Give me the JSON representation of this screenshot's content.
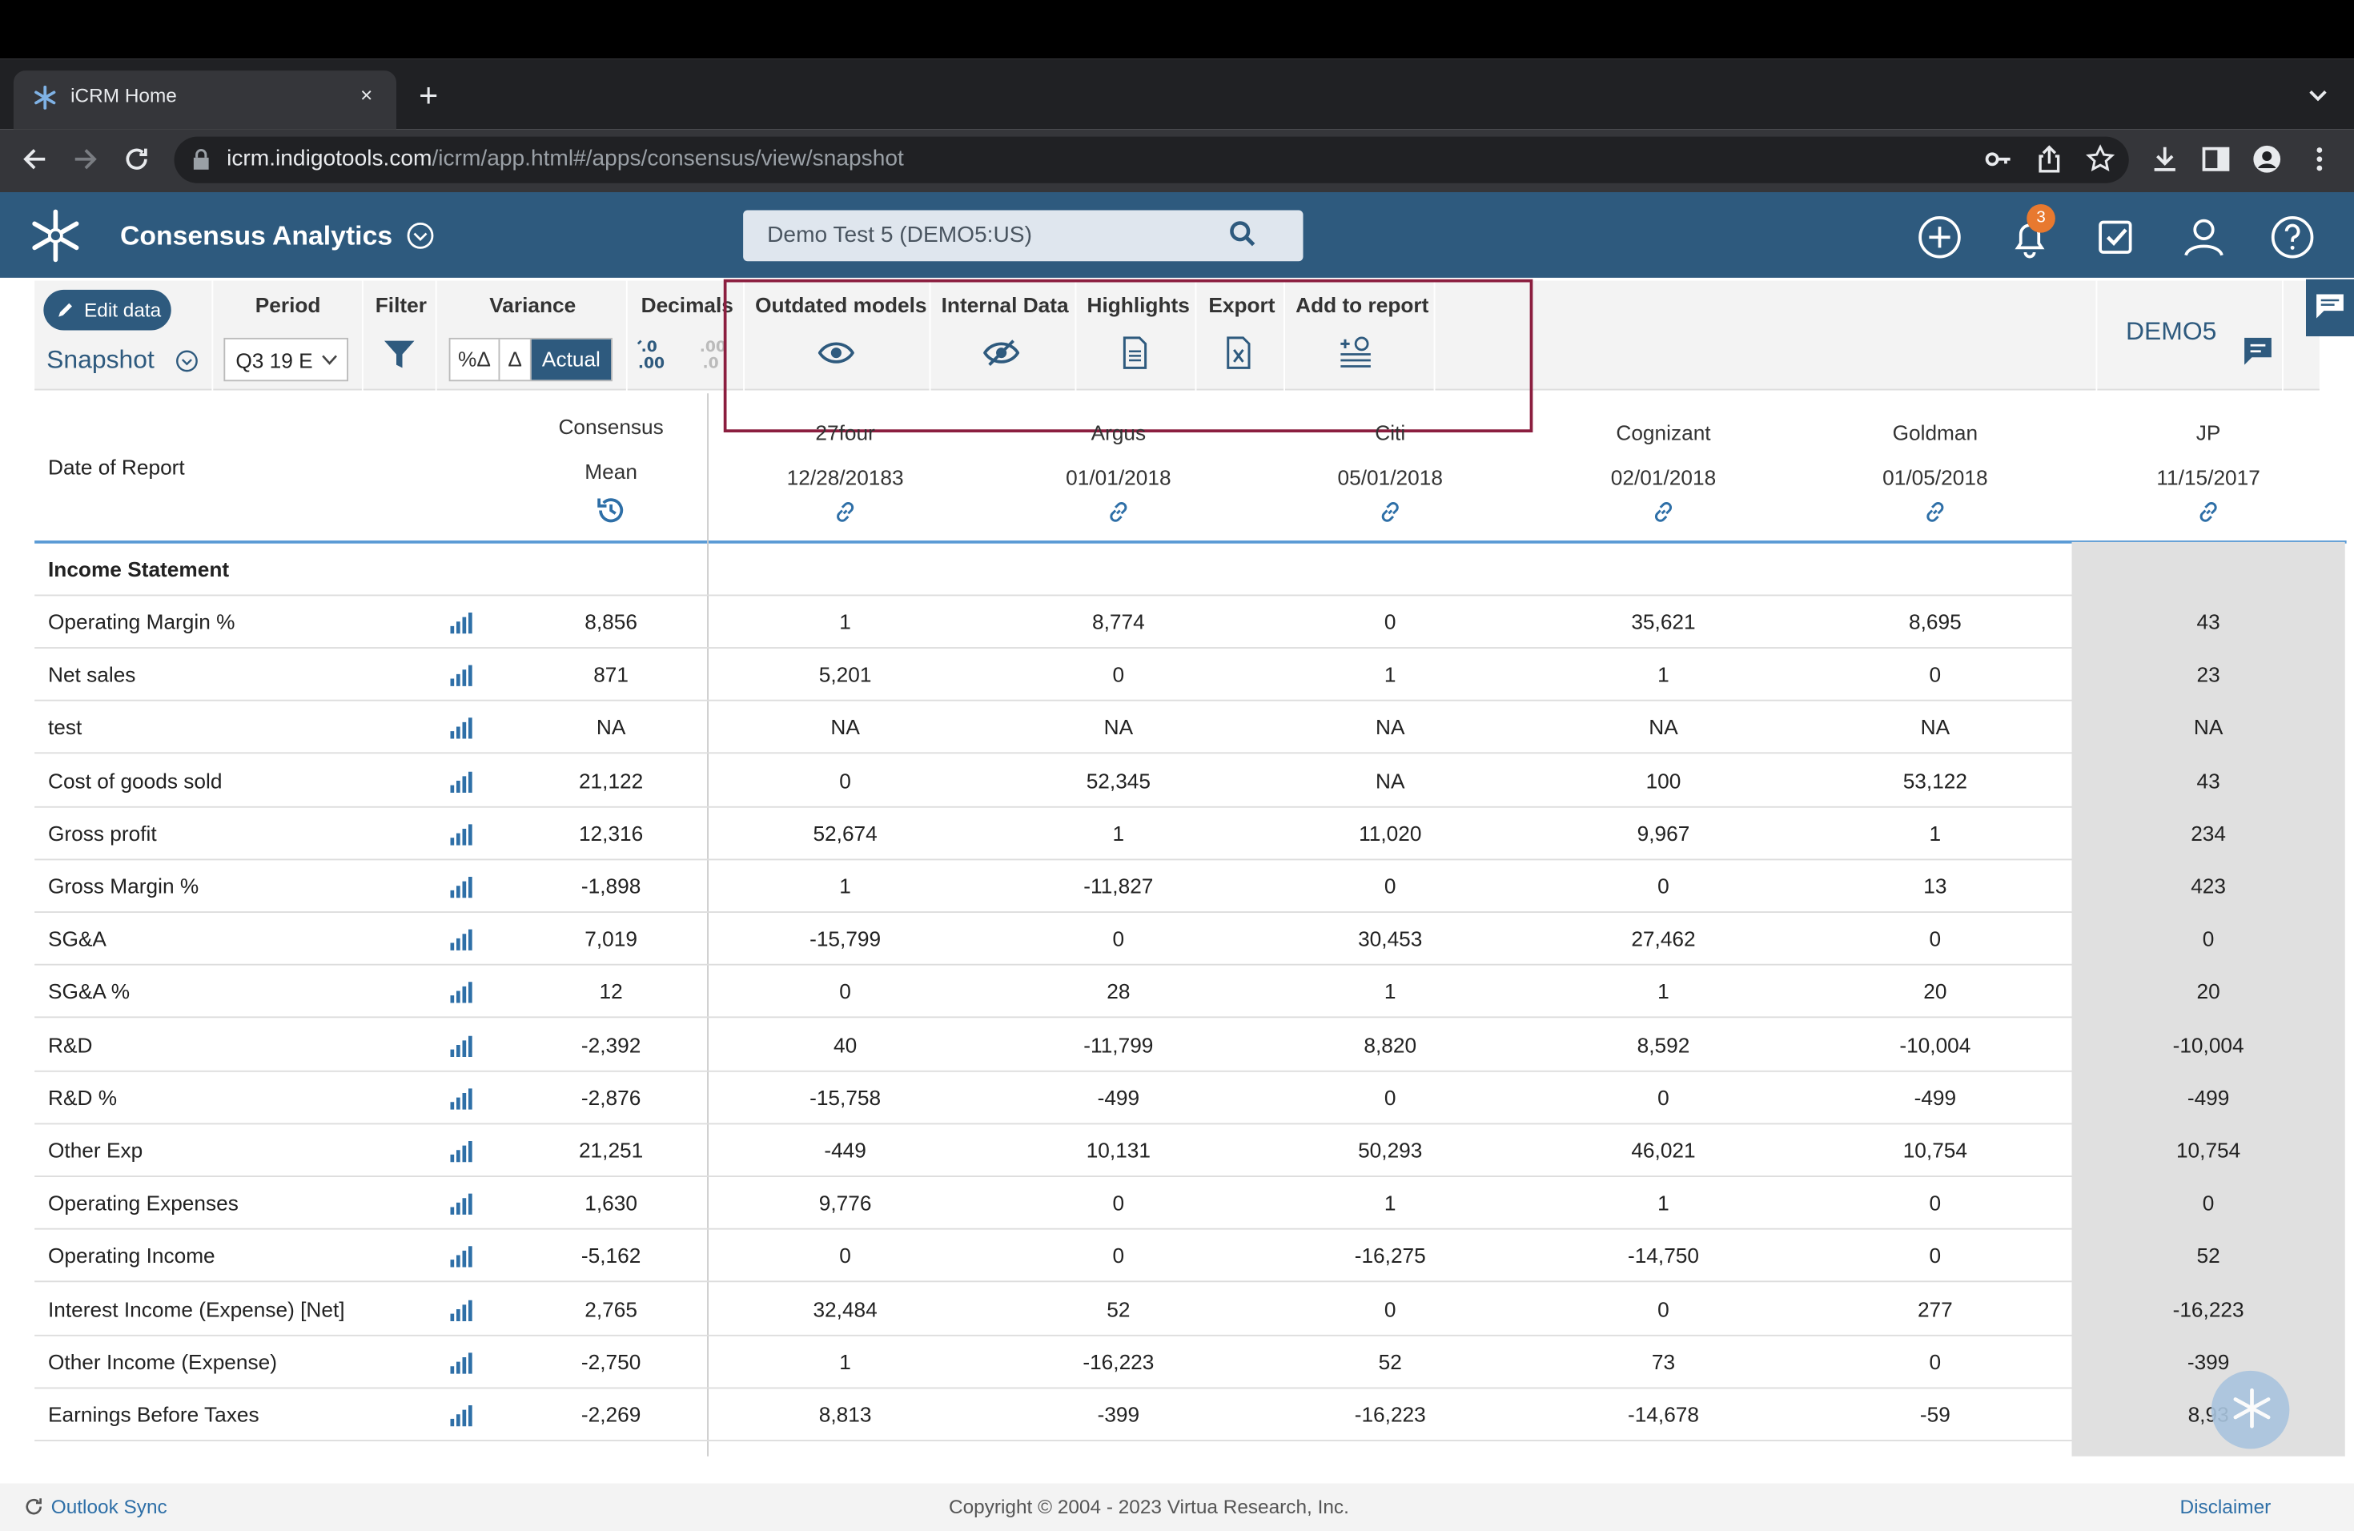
{
  "browser": {
    "tab_title": "iCRM Home",
    "tab_close": "×",
    "new_tab": "+",
    "url_host": "icrm.indigotools.com",
    "url_path": "/icrm/app.html#/apps/consensus/view/snapshot"
  },
  "app": {
    "title": "Consensus Analytics",
    "search_value": "Demo Test 5 (DEMO5:US)",
    "notification_count": "3",
    "accent": "#2e5a7e"
  },
  "toolbar": {
    "edit_label": "Edit data",
    "view_label": "Snapshot",
    "period_label": "Period",
    "period_value": "Q3 19 E",
    "filter_label": "Filter",
    "variance_label": "Variance",
    "variance_options": [
      "%Δ",
      "Δ",
      "Actual"
    ],
    "decimals_label": "Decimals",
    "decimals_inc": ".0\n.00",
    "outdated_label": "Outdated models",
    "internal_label": "Internal Data",
    "highlights_label": "Highlights",
    "export_label": "Export",
    "add_report_label": "Add to report",
    "ticker": "DEMO5"
  },
  "table": {
    "date_label": "Date of Report",
    "consensus_label": "Consensus",
    "mean_label": "Mean",
    "brokers": [
      {
        "name": "27four",
        "date": "12/28/20183"
      },
      {
        "name": "Argus",
        "date": "01/01/2018"
      },
      {
        "name": "Citi",
        "date": "05/01/2018"
      },
      {
        "name": "Cognizant",
        "date": "02/01/2018"
      },
      {
        "name": "Goldman",
        "date": "01/05/2018"
      },
      {
        "name": "JP",
        "date": "11/15/2017"
      }
    ],
    "section": "Income Statement",
    "rows": [
      {
        "label": "Operating Margin %",
        "mean": "8,856",
        "vals": [
          "1",
          "8,774",
          "0",
          "35,621",
          "8,695",
          "43"
        ]
      },
      {
        "label": "Net sales",
        "mean": "871",
        "vals": [
          "5,201",
          "0",
          "1",
          "1",
          "0",
          "23"
        ]
      },
      {
        "label": "test",
        "mean": "NA",
        "vals": [
          "NA",
          "NA",
          "NA",
          "NA",
          "NA",
          "NA"
        ]
      },
      {
        "label": "Cost of goods sold",
        "mean": "21,122",
        "vals": [
          "0",
          "52,345",
          "NA",
          "100",
          "53,122",
          "43"
        ]
      },
      {
        "label": "Gross profit",
        "mean": "12,316",
        "vals": [
          "52,674",
          "1",
          "11,020",
          "9,967",
          "1",
          "234"
        ]
      },
      {
        "label": "Gross Margin %",
        "mean": "-1,898",
        "vals": [
          "1",
          "-11,827",
          "0",
          "0",
          "13",
          "423"
        ]
      },
      {
        "label": "SG&A",
        "mean": "7,019",
        "vals": [
          "-15,799",
          "0",
          "30,453",
          "27,462",
          "0",
          "0"
        ]
      },
      {
        "label": "SG&A %",
        "mean": "12",
        "vals": [
          "0",
          "28",
          "1",
          "1",
          "20",
          "20"
        ]
      },
      {
        "label": "R&D",
        "mean": "-2,392",
        "vals": [
          "40",
          "-11,799",
          "8,820",
          "8,592",
          "-10,004",
          "-10,004"
        ]
      },
      {
        "label": "R&D %",
        "mean": "-2,876",
        "vals": [
          "-15,758",
          "-499",
          "0",
          "0",
          "-499",
          "-499"
        ]
      },
      {
        "label": "Other Exp",
        "mean": "21,251",
        "vals": [
          "-449",
          "10,131",
          "50,293",
          "46,021",
          "10,754",
          "10,754"
        ]
      },
      {
        "label": "Operating Expenses",
        "mean": "1,630",
        "vals": [
          "9,776",
          "0",
          "1",
          "1",
          "0",
          "0"
        ]
      },
      {
        "label": "Operating Income",
        "mean": "-5,162",
        "vals": [
          "0",
          "0",
          "-16,275",
          "-14,750",
          "0",
          "52"
        ]
      },
      {
        "label": "Interest Income (Expense) [Net]",
        "mean": "2,765",
        "vals": [
          "32,484",
          "52",
          "0",
          "0",
          "277",
          "-16,223"
        ]
      },
      {
        "label": "Other Income (Expense)",
        "mean": "-2,750",
        "vals": [
          "1",
          "-16,223",
          "52",
          "73",
          "0",
          "-399"
        ]
      },
      {
        "label": "Earnings Before Taxes",
        "mean": "-2,269",
        "vals": [
          "8,813",
          "-399",
          "-16,223",
          "-14,678",
          "-59",
          "8,93"
        ]
      }
    ]
  },
  "footer": {
    "sync": "Outlook Sync",
    "copyright": "Copyright © 2004 - 2023 Virtua Research, Inc.",
    "disclaimer": "Disclaimer"
  }
}
